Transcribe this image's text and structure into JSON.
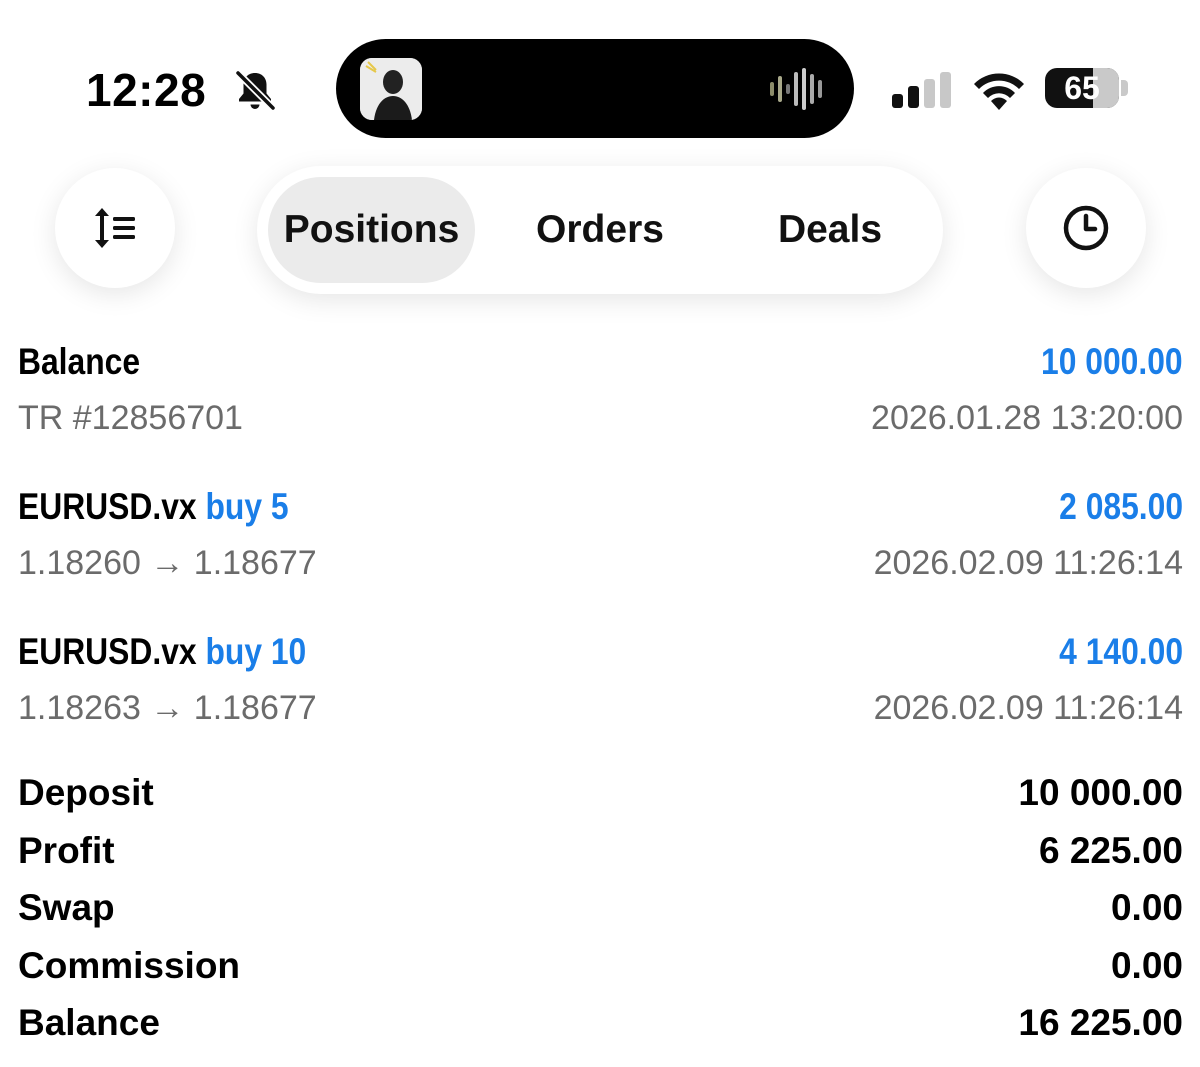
{
  "status_bar": {
    "time": "12:28",
    "battery": "65",
    "battery_level": 0.65,
    "icons": [
      "bell-slash-icon",
      "audio-waveform-icon",
      "cellular-signal-icon",
      "wifi-icon",
      "battery-icon"
    ]
  },
  "toolbar": {
    "sort_icon": "sort-lines-icon",
    "history_icon": "clock-icon",
    "tabs": [
      {
        "label": "Positions",
        "active": true
      },
      {
        "label": "Orders",
        "active": false
      },
      {
        "label": "Deals",
        "active": false
      }
    ]
  },
  "deals": [
    {
      "title": "Balance",
      "kind": "",
      "amount": "10 000.00",
      "detail": "TR #12856701",
      "time": "2026.01.28 13:20:00"
    },
    {
      "title": "EURUSD.vx",
      "kind": "buy 5",
      "amount": "2 085.00",
      "detail": "1.18260 → 1.18677",
      "time": "2026.02.09 11:26:14"
    },
    {
      "title": "EURUSD.vx",
      "kind": "buy 10",
      "amount": "4 140.00",
      "detail": "1.18263 → 1.18677",
      "time": "2026.02.09 11:26:14"
    }
  ],
  "summary": [
    {
      "label": "Deposit",
      "value": "10 000.00"
    },
    {
      "label": "Profit",
      "value": "6 225.00"
    },
    {
      "label": "Swap",
      "value": "0.00"
    },
    {
      "label": "Commission",
      "value": "0.00"
    },
    {
      "label": "Balance",
      "value": "16 225.00"
    }
  ],
  "colors": {
    "accent_blue": "#1a7ee8",
    "secondary_text": "#6b6b6b",
    "active_tab_bg": "#ebebeb"
  }
}
